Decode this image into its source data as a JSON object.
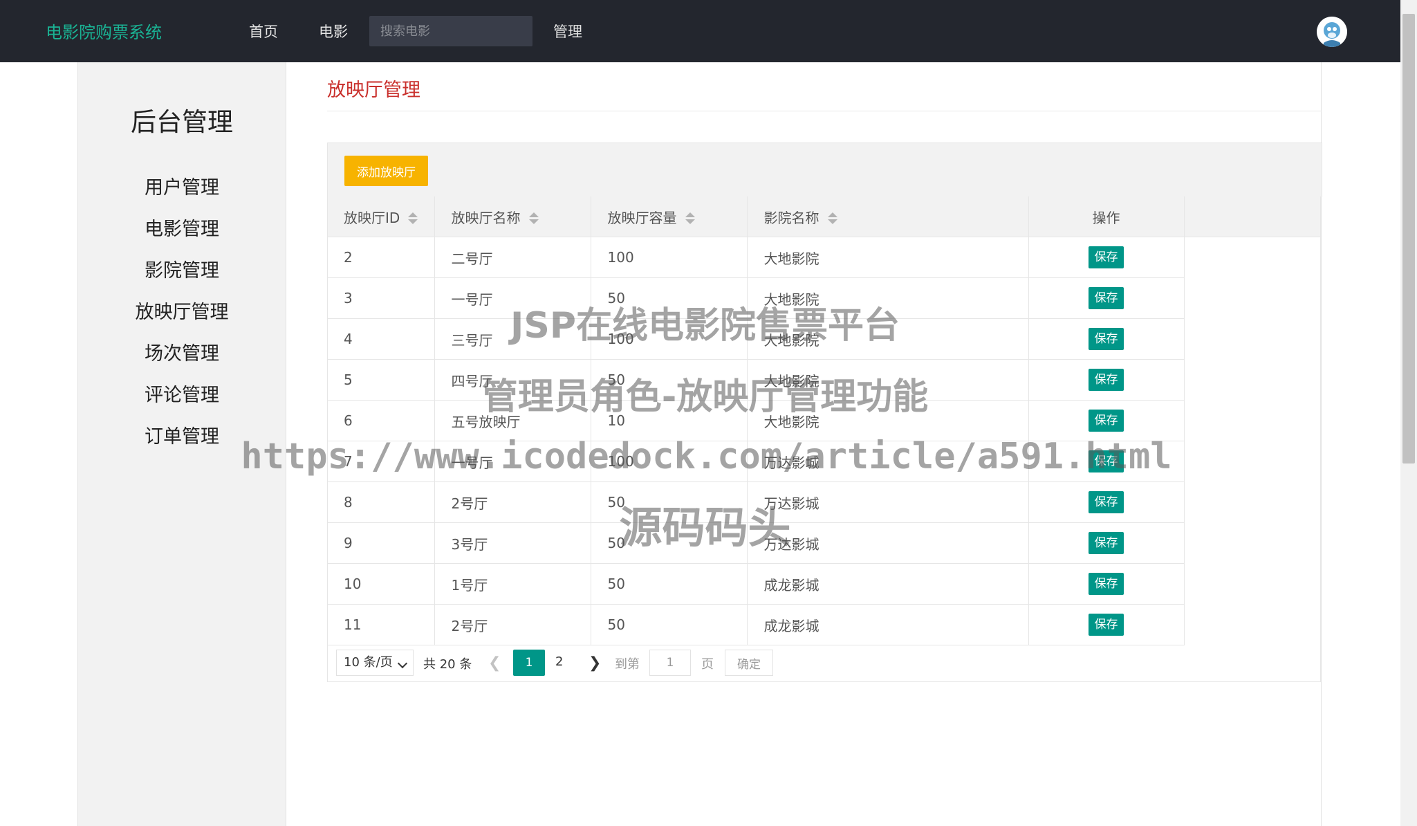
{
  "header": {
    "brand": "电影院购票系统",
    "nav": [
      "首页",
      "电影",
      "管理"
    ],
    "search_placeholder": "搜索电影"
  },
  "sidebar": {
    "title": "后台管理",
    "items": [
      "用户管理",
      "电影管理",
      "影院管理",
      "放映厅管理",
      "场次管理",
      "评论管理",
      "订单管理"
    ]
  },
  "main": {
    "title": "放映厅管理",
    "add_button": "添加放映厅",
    "columns": [
      "放映厅ID",
      "放映厅名称",
      "放映厅容量",
      "影院名称",
      "操作"
    ],
    "rows": [
      {
        "id": "2",
        "name": "二号厅",
        "capacity": "100",
        "cinema": "大地影院",
        "action": "保存"
      },
      {
        "id": "3",
        "name": "一号厅",
        "capacity": "50",
        "cinema": "大地影院",
        "action": "保存"
      },
      {
        "id": "4",
        "name": "三号厅",
        "capacity": "100",
        "cinema": "大地影院",
        "action": "保存"
      },
      {
        "id": "5",
        "name": "四号厅",
        "capacity": "50",
        "cinema": "大地影院",
        "action": "保存"
      },
      {
        "id": "6",
        "name": "五号放映厅",
        "capacity": "10",
        "cinema": "大地影院",
        "action": "保存"
      },
      {
        "id": "7",
        "name": "一号厅",
        "capacity": "100",
        "cinema": "万达影城",
        "action": "保存"
      },
      {
        "id": "8",
        "name": "2号厅",
        "capacity": "50",
        "cinema": "万达影城",
        "action": "保存"
      },
      {
        "id": "9",
        "name": "3号厅",
        "capacity": "50",
        "cinema": "万达影城",
        "action": "保存"
      },
      {
        "id": "10",
        "name": "1号厅",
        "capacity": "50",
        "cinema": "成龙影城",
        "action": "保存"
      },
      {
        "id": "11",
        "name": "2号厅",
        "capacity": "50",
        "cinema": "成龙影城",
        "action": "保存"
      }
    ]
  },
  "pagination": {
    "limit": "10 条/页",
    "total": "共 20 条",
    "current_page": "1",
    "next_page": "2",
    "goto_label": "到第",
    "goto_value": "1",
    "page_suffix": "页",
    "confirm": "确定"
  },
  "watermark": {
    "line1": "JSP在线电影院售票平台",
    "line2": "管理员角色-放映厅管理功能",
    "line3": "https://www.icodedock.com/article/a591.html",
    "line4": "源码码头"
  },
  "colors": {
    "topbar": "#23262e",
    "brand": "#1ab394",
    "accent": "#009688",
    "add_button": "#f7b300",
    "page_title": "#c9302c"
  }
}
